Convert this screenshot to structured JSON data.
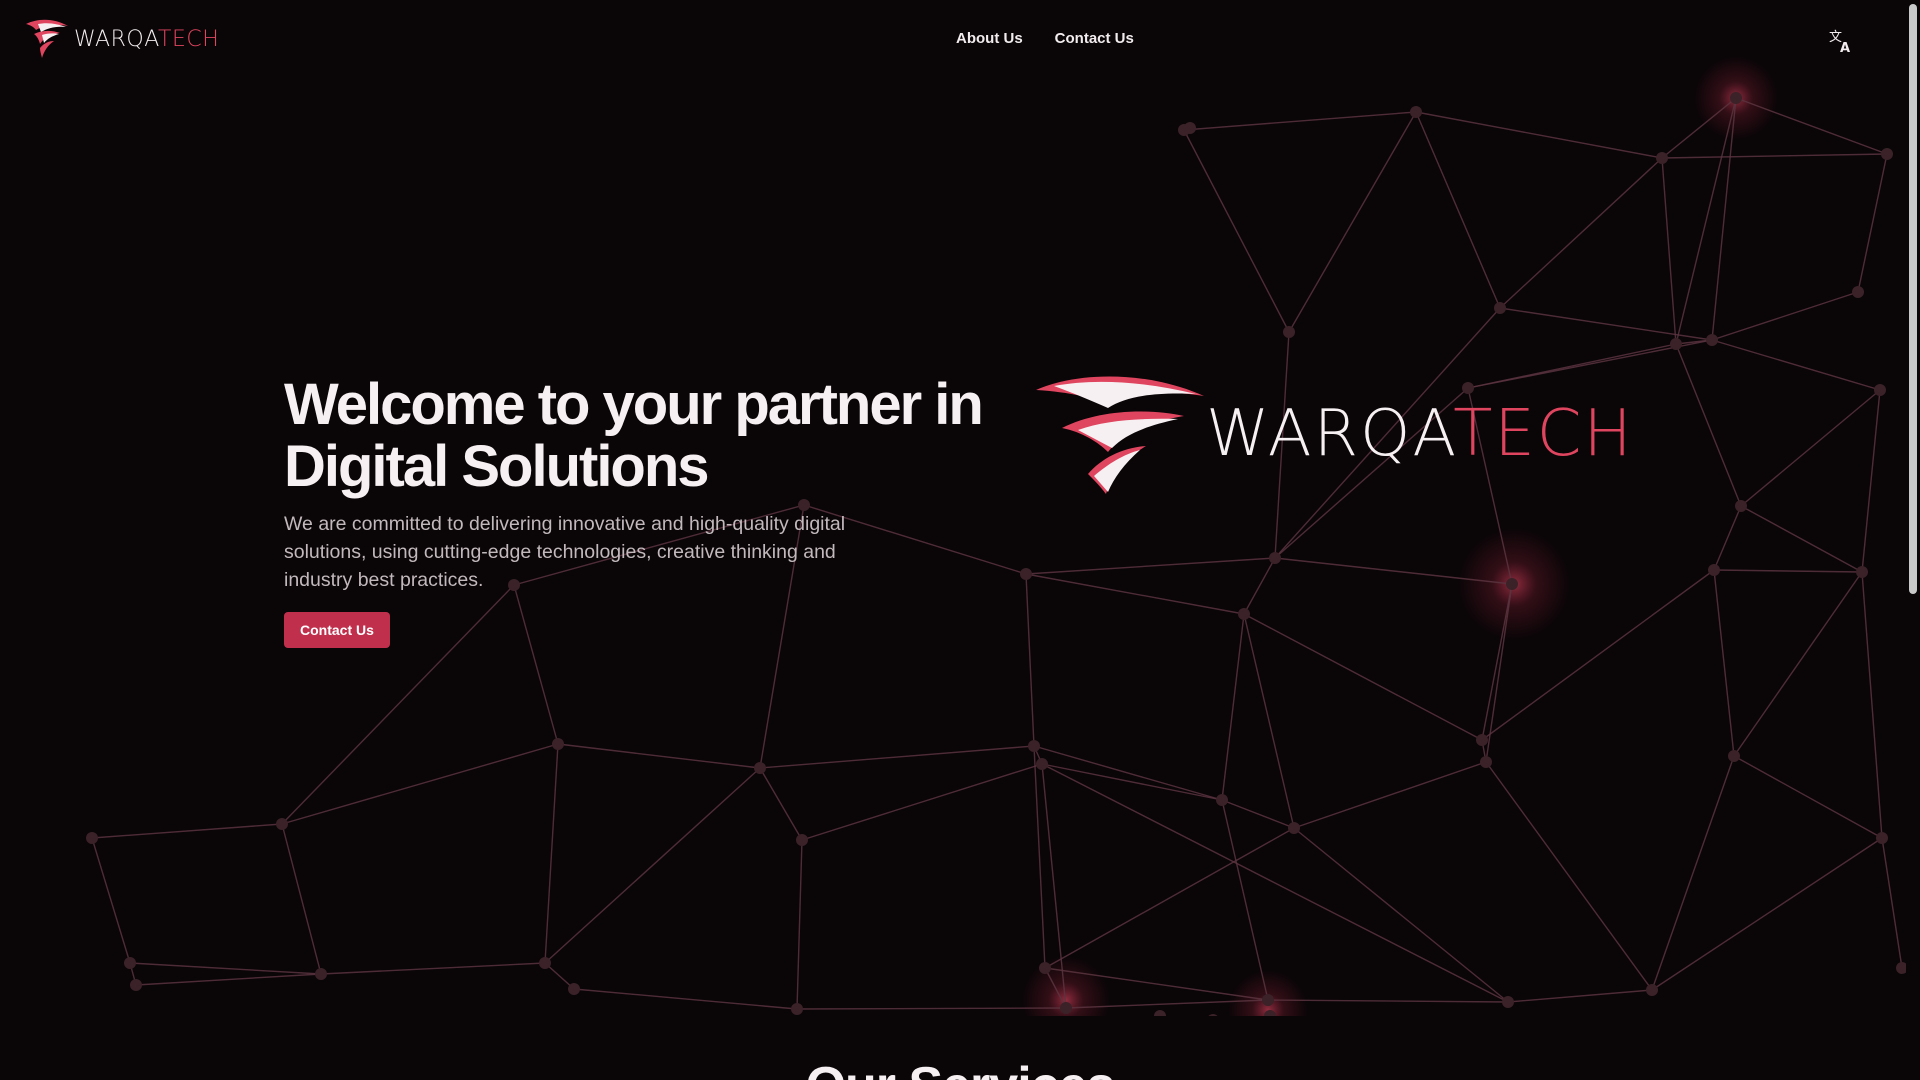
{
  "header": {
    "brand": {
      "word_primary": "WARQA",
      "word_accent": "TECH"
    },
    "nav": [
      {
        "label": "About Us"
      },
      {
        "label": "Contact Us"
      }
    ],
    "translate_icon": "translate-icon"
  },
  "hero": {
    "title": "Welcome to your partner in Digital Solutions",
    "description": "We are committed to delivering innovative and high-quality digital solutions, using cutting-edge technologies, creative thinking and industry best practices.",
    "cta_label": "Contact Us",
    "logo": {
      "word_primary": "WARQA",
      "word_accent": "TECH"
    }
  },
  "services": {
    "heading": "Our Services"
  },
  "colors": {
    "background": "#0a0507",
    "accent": "#c0304d",
    "brand_red": "#e0455f",
    "text": "#f6f0f2"
  }
}
